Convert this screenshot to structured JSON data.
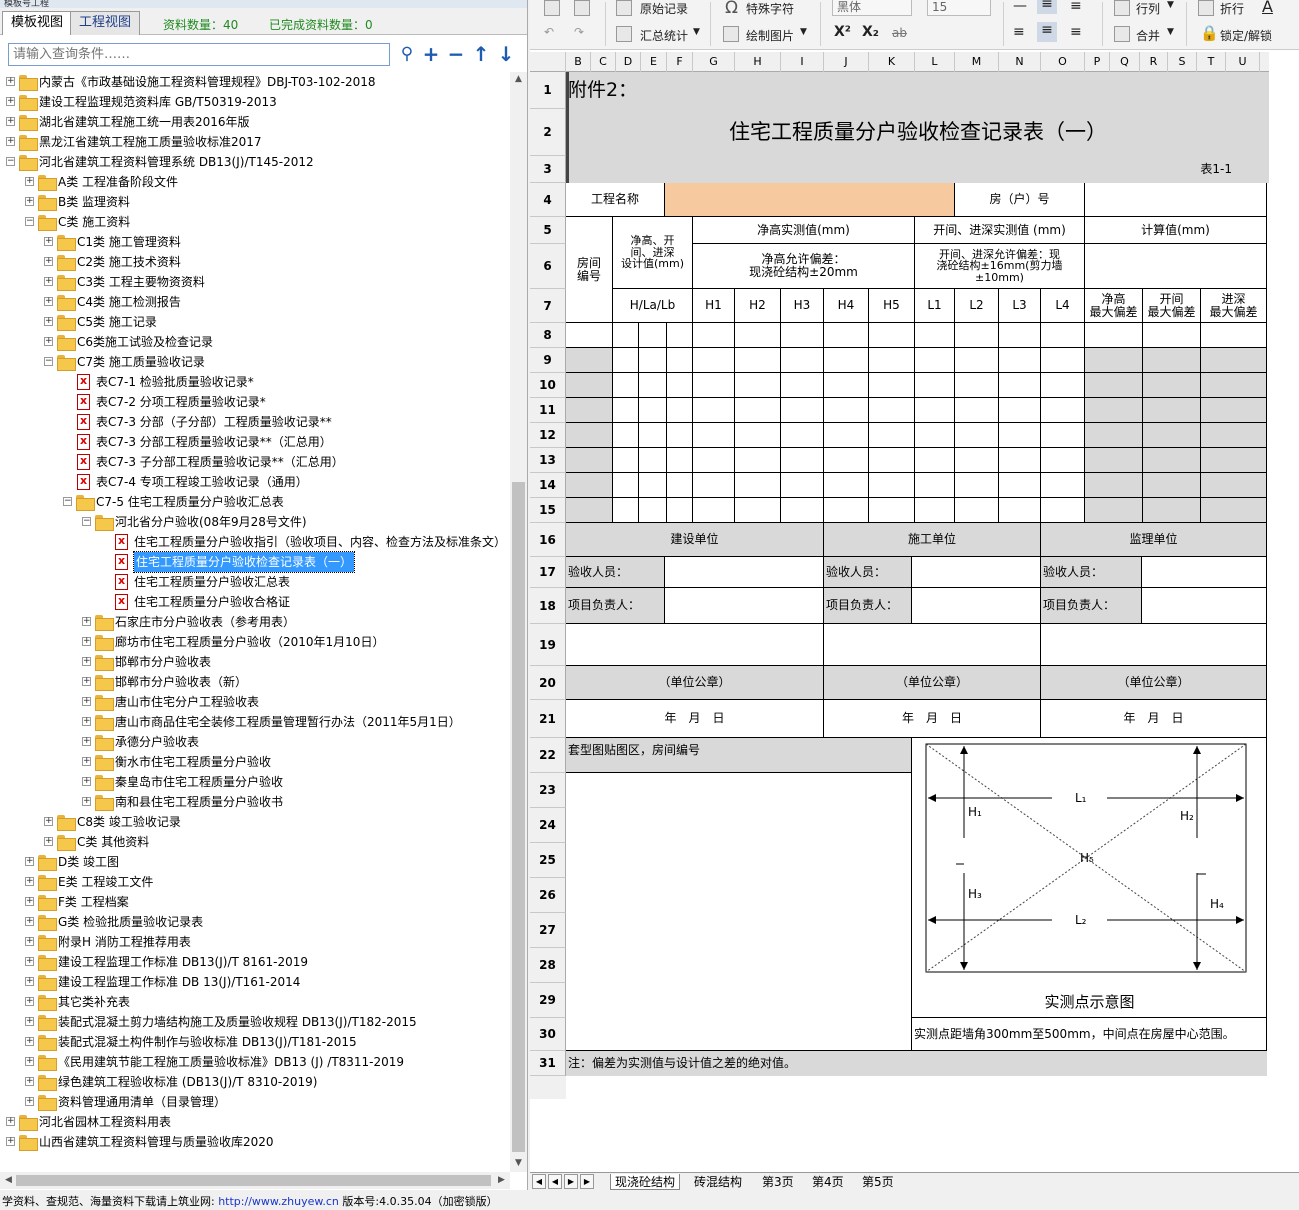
{
  "window_title": "模板号工程",
  "tabs": [
    "模板视图",
    "工程视图"
  ],
  "stats": {
    "count_label": "资料数量：40",
    "done_label": "已完成资料数量：0"
  },
  "search": {
    "placeholder": "请输入查询条件……"
  },
  "tree": [
    {
      "label": "内蒙古《市政基础设施工程资料管理规程》DBJ-T03-102-2018",
      "level": 0,
      "type": "folder",
      "expanded": false
    },
    {
      "label": "建设工程监理规范资料库 GB/T50319-2013",
      "level": 0,
      "type": "folder",
      "expanded": false
    },
    {
      "label": "湖北省建筑工程施工统一用表2016年版",
      "level": 0,
      "type": "folder",
      "expanded": false
    },
    {
      "label": "黑龙江省建筑工程施工质量验收标准2017",
      "level": 0,
      "type": "folder",
      "expanded": false
    },
    {
      "label": "河北省建筑工程资料管理系统 DB13(J)/T145-2012",
      "level": 0,
      "type": "folder",
      "expanded": true
    },
    {
      "label": "A类 工程准备阶段文件",
      "level": 1,
      "type": "folder",
      "expanded": false
    },
    {
      "label": "B类 监理资料",
      "level": 1,
      "type": "folder",
      "expanded": false
    },
    {
      "label": "C类 施工资料",
      "level": 1,
      "type": "folder",
      "expanded": true
    },
    {
      "label": "C1类 施工管理资料",
      "level": 2,
      "type": "folder",
      "expanded": false
    },
    {
      "label": "C2类 施工技术资料",
      "level": 2,
      "type": "folder",
      "expanded": false
    },
    {
      "label": "C3类 工程主要物资资料",
      "level": 2,
      "type": "folder",
      "expanded": false
    },
    {
      "label": "C4类 施工检测报告",
      "level": 2,
      "type": "folder",
      "expanded": false
    },
    {
      "label": "C5类 施工记录",
      "level": 2,
      "type": "folder",
      "expanded": false
    },
    {
      "label": "C6类施工试验及检查记录",
      "level": 2,
      "type": "folder",
      "expanded": false
    },
    {
      "label": "C7类 施工质量验收记录",
      "level": 2,
      "type": "folder",
      "expanded": true
    },
    {
      "label": "表C7-1 检验批质量验收记录*",
      "level": 3,
      "type": "doc"
    },
    {
      "label": "表C7-2 分项工程质量验收记录*",
      "level": 3,
      "type": "doc"
    },
    {
      "label": "表C7-3 分部（子分部）工程质量验收记录**",
      "level": 3,
      "type": "doc"
    },
    {
      "label": "表C7-3 分部工程质量验收记录**（汇总用）",
      "level": 3,
      "type": "doc"
    },
    {
      "label": "表C7-3 子分部工程质量验收记录**（汇总用）",
      "level": 3,
      "type": "doc"
    },
    {
      "label": "表C7-4 专项工程竣工验收记录（通用）",
      "level": 3,
      "type": "doc"
    },
    {
      "label": "C7-5 住宅工程质量分户验收汇总表",
      "level": 3,
      "type": "folder",
      "expanded": true
    },
    {
      "label": "河北省分户验收(08年9月28号文件)",
      "level": 4,
      "type": "folder",
      "expanded": true
    },
    {
      "label": "住宅工程质量分户验收指引（验收项目、内容、检查方法及标准条文）",
      "level": 5,
      "type": "doc"
    },
    {
      "label": "住宅工程质量分户验收检查记录表（一）",
      "level": 5,
      "type": "doc",
      "selected": true
    },
    {
      "label": "住宅工程质量分户验收汇总表",
      "level": 5,
      "type": "doc"
    },
    {
      "label": "住宅工程质量分户验收合格证",
      "level": 5,
      "type": "doc"
    },
    {
      "label": "石家庄市分户验收表（参考用表）",
      "level": 4,
      "type": "folder",
      "expanded": false
    },
    {
      "label": "廊坊市住宅工程质量分户验收（2010年1月10日）",
      "level": 4,
      "type": "folder",
      "expanded": false
    },
    {
      "label": "邯郸市分户验收表",
      "level": 4,
      "type": "folder",
      "expanded": false
    },
    {
      "label": "邯郸市分户验收表（新）",
      "level": 4,
      "type": "folder",
      "expanded": false
    },
    {
      "label": "唐山市住宅分户工程验收表",
      "level": 4,
      "type": "folder",
      "expanded": false
    },
    {
      "label": "唐山市商品住宅全装修工程质量管理暂行办法（2011年5月1日）",
      "level": 4,
      "type": "folder",
      "expanded": false
    },
    {
      "label": "承德分户验收表",
      "level": 4,
      "type": "folder",
      "expanded": false
    },
    {
      "label": "衡水市住宅工程质量分户验收",
      "level": 4,
      "type": "folder",
      "expanded": false
    },
    {
      "label": "秦皇岛市住宅工程质量分户验收",
      "level": 4,
      "type": "folder",
      "expanded": false
    },
    {
      "label": "南和县住宅工程质量分户验收书",
      "level": 4,
      "type": "folder",
      "expanded": false
    },
    {
      "label": "C8类 竣工验收记录",
      "level": 2,
      "type": "folder",
      "expanded": false
    },
    {
      "label": "C类 其他资料",
      "level": 2,
      "type": "folder",
      "expanded": false
    },
    {
      "label": "D类 竣工图",
      "level": 1,
      "type": "folder",
      "expanded": false
    },
    {
      "label": "E类 工程竣工文件",
      "level": 1,
      "type": "folder",
      "expanded": false
    },
    {
      "label": "F类 工程档案",
      "level": 1,
      "type": "folder",
      "expanded": false
    },
    {
      "label": "G类 检验批质量验收记录表",
      "level": 1,
      "type": "folder",
      "expanded": false
    },
    {
      "label": "附录H 消防工程推荐用表",
      "level": 1,
      "type": "folder",
      "expanded": false
    },
    {
      "label": "建设工程监理工作标准 DB13(J)/T 8161-2019",
      "level": 1,
      "type": "folder",
      "expanded": false
    },
    {
      "label": "建设工程监理工作标准 DB 13(J)/T161-2014",
      "level": 1,
      "type": "folder",
      "expanded": false
    },
    {
      "label": "其它类补充表",
      "level": 1,
      "type": "folder",
      "expanded": false
    },
    {
      "label": "装配式混凝土剪力墙结构施工及质量验收规程 DB13(J)/T182-2015",
      "level": 1,
      "type": "folder",
      "expanded": false
    },
    {
      "label": "装配式混凝土构件制作与验收标准 DB13(J)/T181-2015",
      "level": 1,
      "type": "folder",
      "expanded": false
    },
    {
      "label": "《民用建筑节能工程施工质量验收标准》DB13 (J) /T8311-2019",
      "level": 1,
      "type": "folder",
      "expanded": false
    },
    {
      "label": "绿色建筑工程验收标准 (DB13(J)/T 8310-2019)",
      "level": 1,
      "type": "folder",
      "expanded": false
    },
    {
      "label": "资料管理通用清单（目录管理）",
      "level": 1,
      "type": "folder",
      "expanded": false
    },
    {
      "label": "河北省园林工程资料用表",
      "level": 0,
      "type": "folder",
      "expanded": false
    },
    {
      "label": "山西省建筑工程资料管理与质量验收库2020",
      "level": 0,
      "type": "folder",
      "expanded": false
    }
  ],
  "status_bar": {
    "prefix": "学资料、查规范、海量资料下载请上筑业网: ",
    "url": "http://www.zhuyew.cn",
    "version": "  版本号:4.0.35.04（加密锁版）"
  },
  "ribbon": {
    "original_record": "原始记录",
    "special_char": "特殊字符",
    "summary_stats": "汇总统计",
    "draw_image": "绘制图片",
    "font_name": "黑体",
    "font_size": "15",
    "row_col": "行列",
    "wrap": "折行",
    "merge": "合并",
    "lock_unlock": "锁定/解锁",
    "superscript": "X²",
    "subscript": "X₂",
    "strike": "ab"
  },
  "columns": [
    "B",
    "C",
    "D",
    "E",
    "F",
    "G",
    "H",
    "I",
    "J",
    "K",
    "L",
    "M",
    "N",
    "O",
    "P",
    "Q",
    "R",
    "S",
    "T",
    "U"
  ],
  "rows": [
    "1",
    "2",
    "3",
    "4",
    "5",
    "6",
    "7",
    "8",
    "9",
    "10",
    "11",
    "12",
    "13",
    "14",
    "15",
    "16",
    "17",
    "18",
    "19",
    "20",
    "21",
    "22",
    "23",
    "24",
    "25",
    "26",
    "27",
    "28",
    "29",
    "30",
    "31"
  ],
  "form": {
    "attachment": "附件2：",
    "title": "住宅工程质量分户验收检查记录表（一）",
    "table_no": "表1-1",
    "project_name_label": "工程名称",
    "project_name_value": "",
    "house_no_label": "房（户）号",
    "room_no": "房间\n编号",
    "design_value": "净高、开\n间、进深\n设计值(mm)",
    "height_measured": "净高实测值(mm)",
    "opening_measured": "开间、进深实测值 (mm)",
    "calc_value": "计算值(mm)",
    "height_tolerance": "净高允许偏差：\n现浇砼结构±20mm",
    "opening_tolerance": "开间、进深允许偏差：现\n浇砼结构±16mm(剪力墙\n±10mm)",
    "hla": "H/La/Lb",
    "h_cols": [
      "H1",
      "H2",
      "H3",
      "H4",
      "H5"
    ],
    "l_cols": [
      "L1",
      "L2",
      "L3",
      "L4"
    ],
    "max_dev": [
      "净高\n最大偏差",
      "开间\n最大偏差",
      "进深\n最大偏差"
    ],
    "units": [
      "建设单位",
      "施工单位",
      "监理单位"
    ],
    "inspector": "验收人员：",
    "manager": "项目负责人：",
    "seal": "（单位公章）",
    "date": "年　月　日",
    "paste_area": "套型图贴图区，房间编号",
    "diagram_caption": "实测点示意图",
    "diagram_labels": {
      "l1": "L₁",
      "l2": "L₂",
      "h1": "H₁",
      "h2": "H₂",
      "h3": "H₃",
      "h4": "H₄",
      "h5": "H₅"
    },
    "measure_note": "实测点距墙角300mm至500mm，中间点在房屋中心范围。",
    "footnote": "注：偏差为实测值与设计值之差的绝对值。"
  },
  "sheet_tabs": [
    "现浇砼结构",
    "砖混结构",
    "第3页",
    "第4页",
    "第5页"
  ]
}
